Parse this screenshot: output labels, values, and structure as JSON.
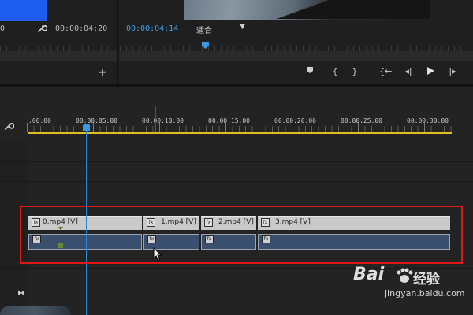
{
  "source_monitor": {
    "timecode_left": "00:00:04:20",
    "timecode_partial": "0"
  },
  "program_monitor": {
    "timecode": "00:00:04:14",
    "fit_label": "适合",
    "transport_icons": [
      "add-marker-icon",
      "mark-in-icon",
      "mark-out-icon",
      "go-to-in-icon",
      "step-back-icon",
      "play-icon",
      "step-forward-icon"
    ]
  },
  "timeline": {
    "ruler_labels": [
      ":00:00",
      "00:00:05:00",
      "00:00:10:00",
      "00:00:15:00",
      "00:00:20:00",
      "00:00:25:00",
      "00:00:30:00"
    ],
    "clips": [
      {
        "fx": "fx",
        "label": "0.mp4 [V]"
      },
      {
        "fx": "fx",
        "label": "1.mp4 [V]"
      },
      {
        "fx": "fx",
        "label": "2.mp4 [V]"
      },
      {
        "fx": "fx",
        "label": "3.mp4 [V]"
      }
    ]
  },
  "colors": {
    "playhead": "#3a9ae8",
    "work_area": "#e0c020",
    "highlight": "#e01818",
    "audio_clip": "#3a4e6e"
  },
  "watermark": {
    "brand_bai": "Bai",
    "brand_du": "经验",
    "url": "jingyan.baidu.com"
  }
}
